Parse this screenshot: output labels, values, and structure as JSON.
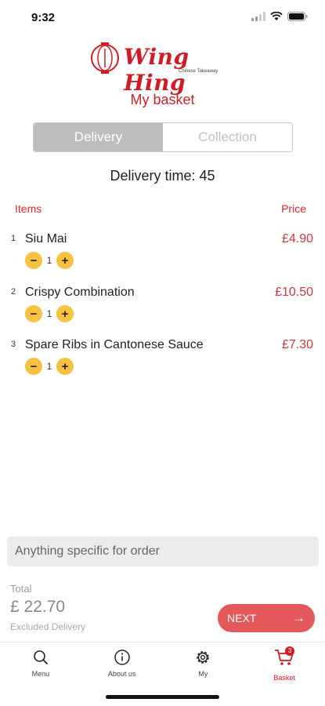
{
  "status": {
    "time": "9:32"
  },
  "brand": {
    "name": "Wing Hing",
    "subtitle": "Chinese Takeaway"
  },
  "page": {
    "title": "My basket"
  },
  "order_type": {
    "options": [
      "Delivery",
      "Collection"
    ],
    "selected": "Delivery"
  },
  "delivery_time": "Delivery time: 45",
  "list_header": {
    "items": "Items",
    "price": "Price"
  },
  "items": [
    {
      "index": "1",
      "name": "Siu Mai",
      "price": "£4.90",
      "qty": "1",
      "minus": "−",
      "plus": "+"
    },
    {
      "index": "2",
      "name": "Crispy Combination",
      "price": "£10.50",
      "qty": "1",
      "minus": "−",
      "plus": "+"
    },
    {
      "index": "3",
      "name": "Spare Ribs in Cantonese Sauce",
      "price": "£7.30",
      "qty": "1",
      "minus": "−",
      "plus": "+"
    }
  ],
  "notes": {
    "placeholder": "Anything specific for order"
  },
  "total": {
    "label": "Total",
    "value": "£ 22.70",
    "note": "Excluded Delivery"
  },
  "next_button": {
    "label": "NEXT",
    "arrow": "→"
  },
  "tabs": [
    {
      "label": "Menu",
      "icon": "search-icon"
    },
    {
      "label": "About us",
      "icon": "info-icon"
    },
    {
      "label": "My",
      "icon": "gear-icon"
    },
    {
      "label": "Basket",
      "icon": "cart-icon",
      "badge": "3",
      "active": true
    }
  ],
  "colors": {
    "brand_red": "#d01c25",
    "accent_yellow": "#f8c140",
    "next_button": "#e4575a"
  }
}
